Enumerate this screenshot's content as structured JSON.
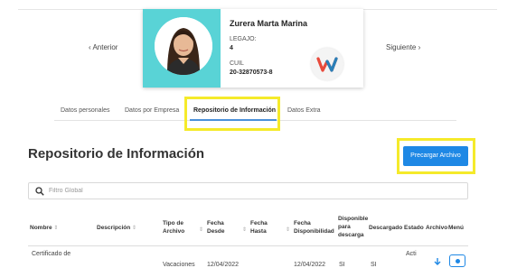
{
  "navigation": {
    "prev_label": "‹ Anterior",
    "next_label": "Siguiente ›"
  },
  "employee": {
    "name": "Zurera Marta Marina",
    "legajo_label": "LEGAJO:",
    "legajo_value": "4",
    "cuil_label": "CUIL",
    "cuil_value": "20-32870573-8"
  },
  "tabs": [
    {
      "label": "Datos personales",
      "active": false
    },
    {
      "label": "Datos por Empresa",
      "active": false
    },
    {
      "label": "Repositorio de Información",
      "active": true
    },
    {
      "label": "Datos Extra",
      "active": false
    }
  ],
  "section": {
    "title": "Repositorio de Información",
    "action_label": "Precargar Archivo"
  },
  "search": {
    "placeholder": "Filtro Global",
    "value": ""
  },
  "table": {
    "columns": [
      "Nombre",
      "Descripción",
      "Tipo de Archivo",
      "Fecha Desde",
      "Fecha Hasta",
      "Fecha Disponibilidad",
      "Disponible para descarga",
      "Descargado",
      "Estado",
      "Archivo",
      "Menú"
    ],
    "rows": [
      {
        "nombre": "Certificado de",
        "descripcion": "",
        "tipo": "Vacaciones",
        "desde": "12/04/2022",
        "hasta": "",
        "disponibilidad": "12/04/2022",
        "disponible": "SI",
        "descargado": "SI",
        "estado": "Acti"
      }
    ]
  },
  "colors": {
    "accent": "#1e88e5",
    "card_bg": "#59d3d6",
    "highlight": "#f5ea2a"
  }
}
